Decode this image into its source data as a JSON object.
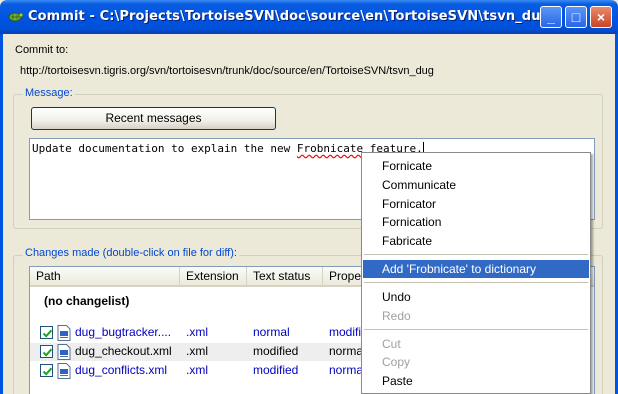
{
  "window": {
    "title": "Commit - C:\\Projects\\TortoiseSVN\\doc\\source\\en\\TortoiseSVN\\tsvn_dug",
    "controls": {
      "minimize": "_",
      "maximize": "□",
      "close": "×"
    }
  },
  "commit_to": {
    "label": "Commit to:",
    "url": "http://tortoisesvn.tigris.org/svn/tortoisesvn/trunk/doc/source/en/TortoiseSVN/tsvn_dug"
  },
  "message": {
    "group_label": "Message:",
    "recent_button": "Recent messages",
    "text_before": "Update documentation to explain the new ",
    "misspelled_word": "Frobnicate",
    "text_after": " feature."
  },
  "changes": {
    "group_label": "Changes made (double-click on file for diff):",
    "columns": [
      "Path",
      "Extension",
      "Text status",
      "Proper"
    ],
    "changelist": "(no changelist)",
    "rows": [
      {
        "path": "dug_bugtracker....",
        "ext": ".xml",
        "status": "normal",
        "prop": "modifie",
        "checked": true,
        "highlight": "blue"
      },
      {
        "path": "dug_checkout.xml",
        "ext": ".xml",
        "status": "modified",
        "prop": "normal",
        "checked": true,
        "highlight": "none"
      },
      {
        "path": "dug_conflicts.xml",
        "ext": ".xml",
        "status": "modified",
        "prop": "normal",
        "checked": true,
        "highlight": "blue"
      }
    ]
  },
  "context_menu": {
    "suggestions": [
      "Fornicate",
      "Communicate",
      "Fornicator",
      "Fornication",
      "Fabricate"
    ],
    "add_to_dictionary": "Add 'Frobnicate' to dictionary",
    "undo": "Undo",
    "redo": "Redo",
    "cut": "Cut",
    "copy": "Copy",
    "paste": "Paste"
  },
  "colors": {
    "titlebar": "#0054e3",
    "menu_highlight": "#316ac5",
    "group_label": "#0046d5",
    "link_blue": "#0000c0"
  }
}
